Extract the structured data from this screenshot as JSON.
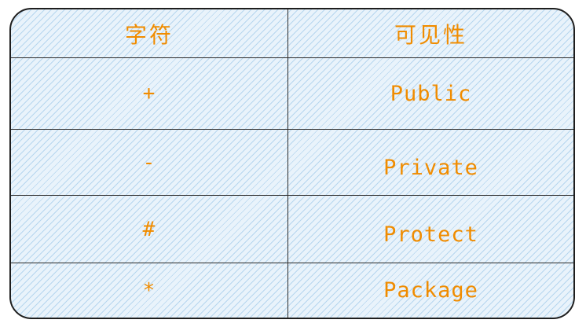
{
  "table": {
    "headers": {
      "symbol": "字符",
      "visibility": "可见性"
    },
    "rows": [
      {
        "symbol": "+",
        "visibility": "Public"
      },
      {
        "symbol": "-",
        "visibility": "Private"
      },
      {
        "symbol": "#",
        "visibility": "Protect"
      },
      {
        "symbol": "*",
        "visibility": "Package"
      }
    ]
  },
  "colors": {
    "text": "#f08c00",
    "stroke": "#1e1e1e",
    "fill": "#a5d8ff"
  }
}
